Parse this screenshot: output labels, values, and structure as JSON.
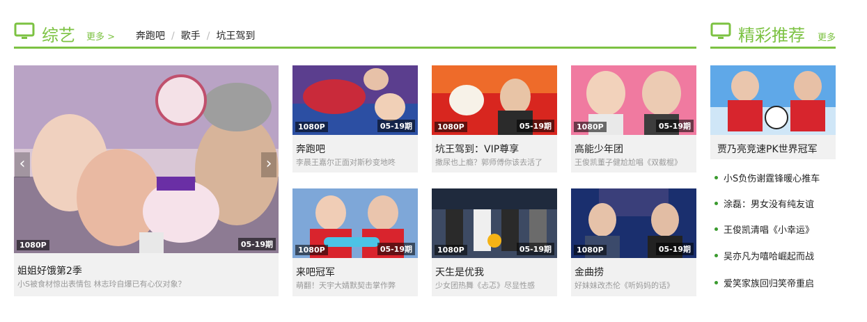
{
  "variety": {
    "title": "综艺",
    "more_label": "更多 >",
    "tabs": [
      "奔跑吧",
      "歌手",
      "坑王驾到"
    ]
  },
  "featured_section": {
    "title": "精彩推荐",
    "more_label": "更多"
  },
  "main_card": {
    "title": "姐姐好饿第2季",
    "subtitle": "小S被食材惊出表情包 林志玲自爆已有心仪对象？",
    "quality": "1080P",
    "episode": "05-19期"
  },
  "cards": [
    {
      "title": "奔跑吧",
      "subtitle": "李晨王嘉尔正面对斯秒变地咚",
      "quality": "1080P",
      "episode": "05-19期"
    },
    {
      "title": "坑王驾到：VIP尊享",
      "subtitle": "撒尿也上瘾？郭师傅你该去活了",
      "quality": "1080P",
      "episode": "05-19期"
    },
    {
      "title": "高能少年团",
      "subtitle": "王俊凯董子健尬尬唱《双截棍》",
      "quality": "1080P",
      "episode": "05-19期"
    },
    {
      "title": "来吧冠军",
      "subtitle": "萌翻！天宇大婧默契击掌作弊",
      "quality": "1080P",
      "episode": "05-19期"
    },
    {
      "title": "天生是优我",
      "subtitle": "少女团热舞《忐忑》尽显性感",
      "quality": "1080P",
      "episode": "05-19期"
    },
    {
      "title": "金曲捞",
      "subtitle": "好妹妹改杰伦《听妈妈的话》",
      "quality": "1080P",
      "episode": "05-19期"
    }
  ],
  "recommend": {
    "top_title": "贾乃亮竞速PK世界冠军",
    "items": [
      "小S负伤谢霆锋暖心推车",
      "涂磊：男女没有纯友谊",
      "王俊凯清唱《小幸运》",
      "吴亦凡为嘻哈崛起而战",
      "爱笑家族回归笑帝重启"
    ]
  },
  "colors": {
    "accent": "#7cc242",
    "dot": "#3a9a2e"
  }
}
